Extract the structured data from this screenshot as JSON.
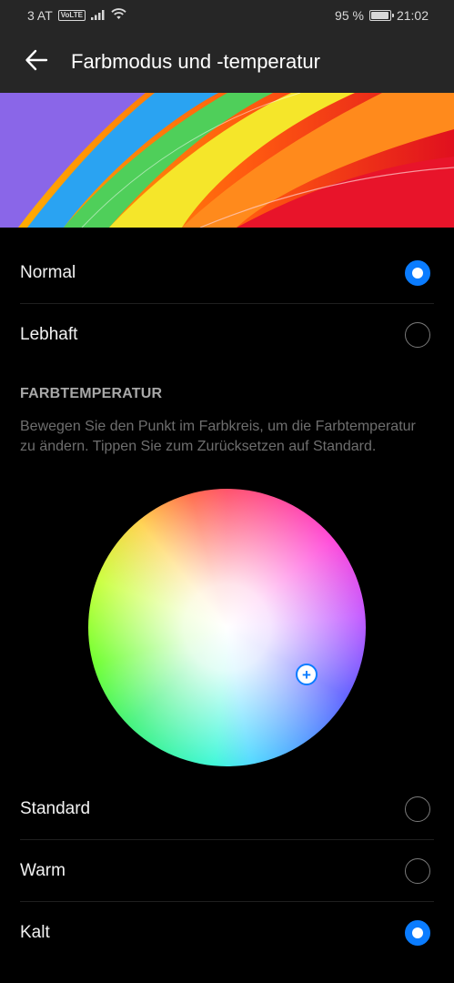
{
  "status_bar": {
    "carrier": "3 AT",
    "volte": "VoLTE",
    "battery_percent": "95 %",
    "battery_level": 0.95,
    "time": "21:02",
    "icons": [
      "signal-icon",
      "wifi-icon",
      "battery-icon"
    ]
  },
  "app_bar": {
    "back_icon": "arrow-left-icon",
    "title": "Farbmodus und -temperatur"
  },
  "color_mode": {
    "options": [
      {
        "label": "Normal",
        "selected": true
      },
      {
        "label": "Lebhaft",
        "selected": false
      }
    ]
  },
  "color_temperature": {
    "title": "FARBTEMPERATUR",
    "description": "Bewegen Sie den Punkt im Farbkreis, um die Farbtemperatur zu ändern. Tippen Sie zum Zurücksetzen auf Standard.",
    "handle_glyph": "+",
    "options": [
      {
        "label": "Standard",
        "selected": false
      },
      {
        "label": "Warm",
        "selected": false
      },
      {
        "label": "Kalt",
        "selected": true
      }
    ]
  },
  "colors": {
    "accent": "#0a7cff",
    "background": "#000000",
    "app_bar": "#262626"
  }
}
